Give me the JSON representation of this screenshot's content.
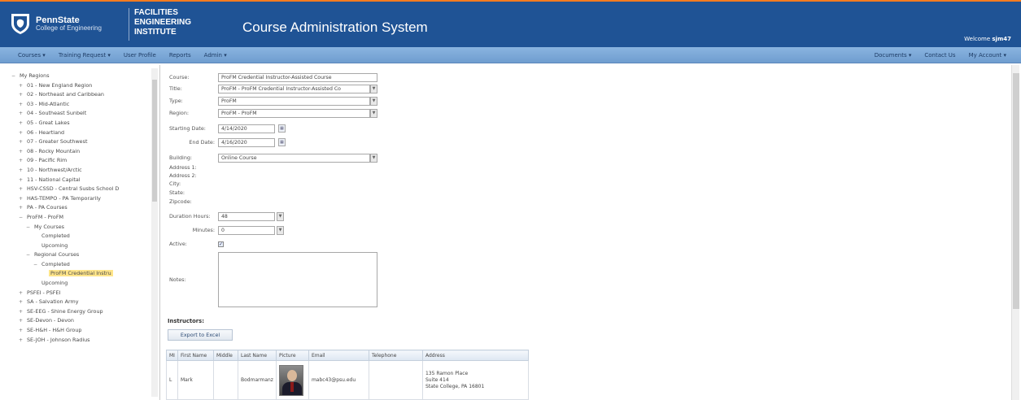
{
  "header": {
    "brand_line1": "PennState",
    "brand_line2": "College of Engineering",
    "institute_line1": "FACILITIES",
    "institute_line2": "ENGINEERING",
    "institute_line3": "INSTITUTE",
    "app_title": "Course Administration System",
    "welcome_label": "Welcome",
    "welcome_user": "sjm47"
  },
  "nav": {
    "left": [
      "Courses ▾",
      "Training Request ▾",
      "User Profile",
      "Reports",
      "Admin ▾"
    ],
    "right": [
      "Documents ▾",
      "Contact Us",
      "My Account ▾"
    ]
  },
  "tree": [
    {
      "indent": 0,
      "toggle": "−",
      "label": "My Regions"
    },
    {
      "indent": 1,
      "toggle": "+",
      "label": "01 - New England Region"
    },
    {
      "indent": 1,
      "toggle": "+",
      "label": "02 - Northeast and Caribbean"
    },
    {
      "indent": 1,
      "toggle": "+",
      "label": "03 - Mid-Atlantic"
    },
    {
      "indent": 1,
      "toggle": "+",
      "label": "04 - Southeast Sunbelt"
    },
    {
      "indent": 1,
      "toggle": "+",
      "label": "05 - Great Lakes"
    },
    {
      "indent": 1,
      "toggle": "+",
      "label": "06 - Heartland"
    },
    {
      "indent": 1,
      "toggle": "+",
      "label": "07 - Greater Southwest"
    },
    {
      "indent": 1,
      "toggle": "+",
      "label": "08 - Rocky Mountain"
    },
    {
      "indent": 1,
      "toggle": "+",
      "label": "09 - Pacific Rim"
    },
    {
      "indent": 1,
      "toggle": "+",
      "label": "10 - Northwest/Arctic"
    },
    {
      "indent": 1,
      "toggle": "+",
      "label": "11 - National Capital"
    },
    {
      "indent": 1,
      "toggle": "+",
      "label": "HSV-CSSD - Central Susbs School D"
    },
    {
      "indent": 1,
      "toggle": "+",
      "label": "HAS-TEMPO - PA Temporarily"
    },
    {
      "indent": 1,
      "toggle": "+",
      "label": "PA - PA Courses"
    },
    {
      "indent": 1,
      "toggle": "−",
      "label": "ProFM - ProFM"
    },
    {
      "indent": 2,
      "toggle": "−",
      "label": "My Courses"
    },
    {
      "indent": 3,
      "toggle": "",
      "label": "Completed"
    },
    {
      "indent": 3,
      "toggle": "",
      "label": "Upcoming"
    },
    {
      "indent": 2,
      "toggle": "−",
      "label": "Regional Courses"
    },
    {
      "indent": 3,
      "toggle": "−",
      "label": "Completed"
    },
    {
      "indent": 4,
      "toggle": "",
      "label": "ProFM Credential Instru",
      "selected": true
    },
    {
      "indent": 3,
      "toggle": "",
      "label": "Upcoming"
    },
    {
      "indent": 1,
      "toggle": "+",
      "label": "PSFEI - PSFEI"
    },
    {
      "indent": 1,
      "toggle": "+",
      "label": "SA - Salvation Army"
    },
    {
      "indent": 1,
      "toggle": "+",
      "label": "SE-EEG - Shine Energy Group"
    },
    {
      "indent": 1,
      "toggle": "+",
      "label": "SE-Devon - Devon"
    },
    {
      "indent": 1,
      "toggle": "+",
      "label": "SE-H&H - H&H Group"
    },
    {
      "indent": 1,
      "toggle": "+",
      "label": "SE-JOH - Johnson Radius"
    }
  ],
  "form": {
    "course_label": "Course:",
    "course_value": "ProFM Credential Instructor-Assisted Course",
    "title_label": "Title:",
    "title_value": "ProFM - ProFM Credential Instructor-Assisted Co",
    "type_label": "Type:",
    "type_value": "ProFM",
    "region_label": "Region:",
    "region_value": "ProFM - ProFM",
    "start_label": "Starting Date:",
    "start_value": "4/14/2020",
    "end_label": "End Date:",
    "end_value": "4/16/2020",
    "building_label": "Building:",
    "building_value": "Online Course",
    "address1_label": "Address 1:",
    "address2_label": "Address 2:",
    "city_label": "City:",
    "state_label": "State:",
    "zip_label": "Zipcode:",
    "duration_label": "Duration Hours:",
    "duration_value": "48",
    "minutes_label": "Minutes:",
    "minutes_value": "0",
    "active_label": "Active:",
    "active_check": "✓",
    "notes_label": "Notes:"
  },
  "instructors": {
    "title": "Instructors:",
    "export_label": "Export to Excel",
    "columns": [
      "MI",
      "First Name",
      "Middle",
      "Last Name",
      "Picture",
      "Email",
      "Telephone",
      "Address"
    ],
    "rows": [
      {
        "mi": "L",
        "first": "Mark",
        "middle": "",
        "last": "Bodmarmanz",
        "email": "mabc43@psu.edu",
        "phone": "",
        "addr1": "135 Ramon Place",
        "addr2": "Suite 414",
        "addr3": "State College, PA 16801"
      }
    ]
  },
  "colors": {
    "header_bg": "#1f5395",
    "accent": "#f47b20",
    "nav_bg": "#7ea9d8",
    "selected": "#ffe58a"
  }
}
